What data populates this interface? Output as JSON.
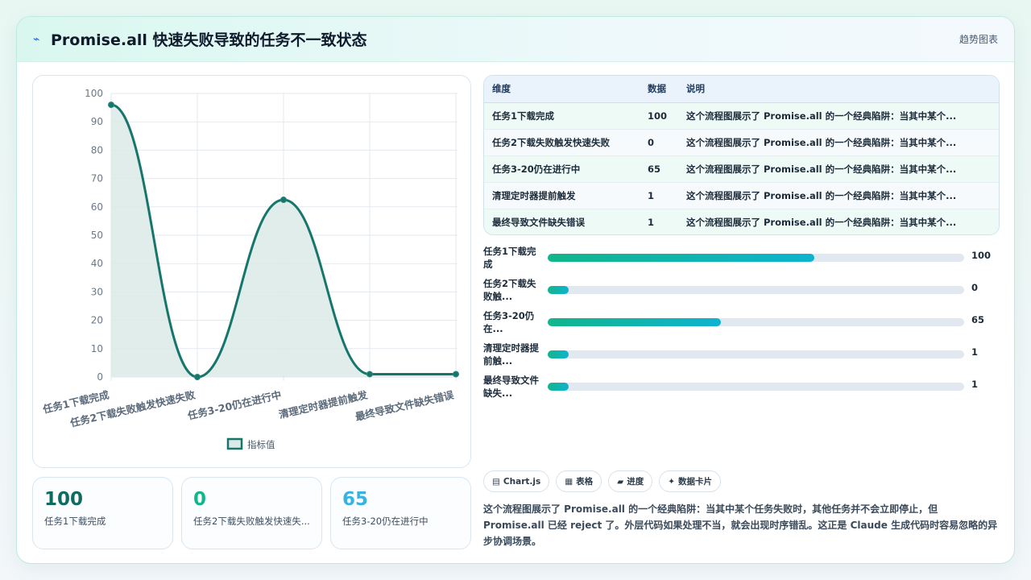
{
  "header": {
    "icon": "zap-icon",
    "title": "Promise.all 快速失败导致的任务不一致状态",
    "link": "趋势图表"
  },
  "chart_data": {
    "type": "area",
    "categories": [
      "任务1下载完成",
      "任务2下载失败触发快速失败",
      "任务3-20仍在进行中",
      "清理定时器提前触发",
      "最终导致文件缺失错误"
    ],
    "series": [
      {
        "name": "指标值",
        "values": [
          96,
          0,
          62.5,
          1,
          1
        ]
      }
    ],
    "ylim": [
      0,
      100
    ],
    "yticks": [
      0,
      10,
      20,
      30,
      40,
      50,
      60,
      70,
      80,
      90,
      100
    ],
    "grid": true,
    "legend": "bottom",
    "colors": {
      "line": "#17766b",
      "fill": "#dbeae8"
    }
  },
  "stats": [
    {
      "value": "100",
      "label": "任务1下载完成",
      "color": "#0f6b62"
    },
    {
      "value": "0",
      "label": "任务2下载失败触发快速失...",
      "color": "#13b58a"
    },
    {
      "value": "65",
      "label": "任务3-20仍在进行中",
      "color": "#38b2e0"
    }
  ],
  "table": {
    "headers": [
      "维度",
      "数据",
      "说明"
    ],
    "rows": [
      {
        "dim": "任务1下载完成",
        "val": "100",
        "note": "这个流程图展示了 Promise.all 的一个经典陷阱：当其中某个..."
      },
      {
        "dim": "任务2下载失败触发快速失败",
        "val": "0",
        "note": "这个流程图展示了 Promise.all 的一个经典陷阱：当其中某个..."
      },
      {
        "dim": "任务3-20仍在进行中",
        "val": "65",
        "note": "这个流程图展示了 Promise.all 的一个经典陷阱：当其中某个..."
      },
      {
        "dim": "清理定时器提前触发",
        "val": "1",
        "note": "这个流程图展示了 Promise.all 的一个经典陷阱：当其中某个..."
      },
      {
        "dim": "最终导致文件缺失错误",
        "val": "1",
        "note": "这个流程图展示了 Promise.all 的一个经典陷阱：当其中某个..."
      }
    ]
  },
  "bars": [
    {
      "l1": "任务1下载完",
      "l2": "成",
      "value": "100",
      "fill": 0.64
    },
    {
      "l1": "任务2下载失",
      "l2": "败触...",
      "value": "0",
      "fill": 0.05
    },
    {
      "l1": "任务3-20仍",
      "l2": "在...",
      "value": "65",
      "fill": 0.415
    },
    {
      "l1": "清理定时器提",
      "l2": "前触...",
      "value": "1",
      "fill": 0.05
    },
    {
      "l1": "最终导致文件",
      "l2": "缺失...",
      "value": "1",
      "fill": 0.05
    }
  ],
  "chips": [
    {
      "icon": "chart-icon",
      "glyph": "▤",
      "label": "Chart.js"
    },
    {
      "icon": "table-icon",
      "glyph": "▦",
      "label": "表格"
    },
    {
      "icon": "progress-icon",
      "glyph": "▰",
      "label": "进度"
    },
    {
      "icon": "sparkle-icon",
      "glyph": "✦",
      "label": "数据卡片"
    }
  ],
  "description": "这个流程图展示了 Promise.all 的一个经典陷阱：当其中某个任务失败时，其他任务并不会立即停止，但 Promise.all 已经 reject 了。外层代码如果处理不当，就会出现时序错乱。这正是 Claude 生成代码时容易忽略的异步协调场景。"
}
